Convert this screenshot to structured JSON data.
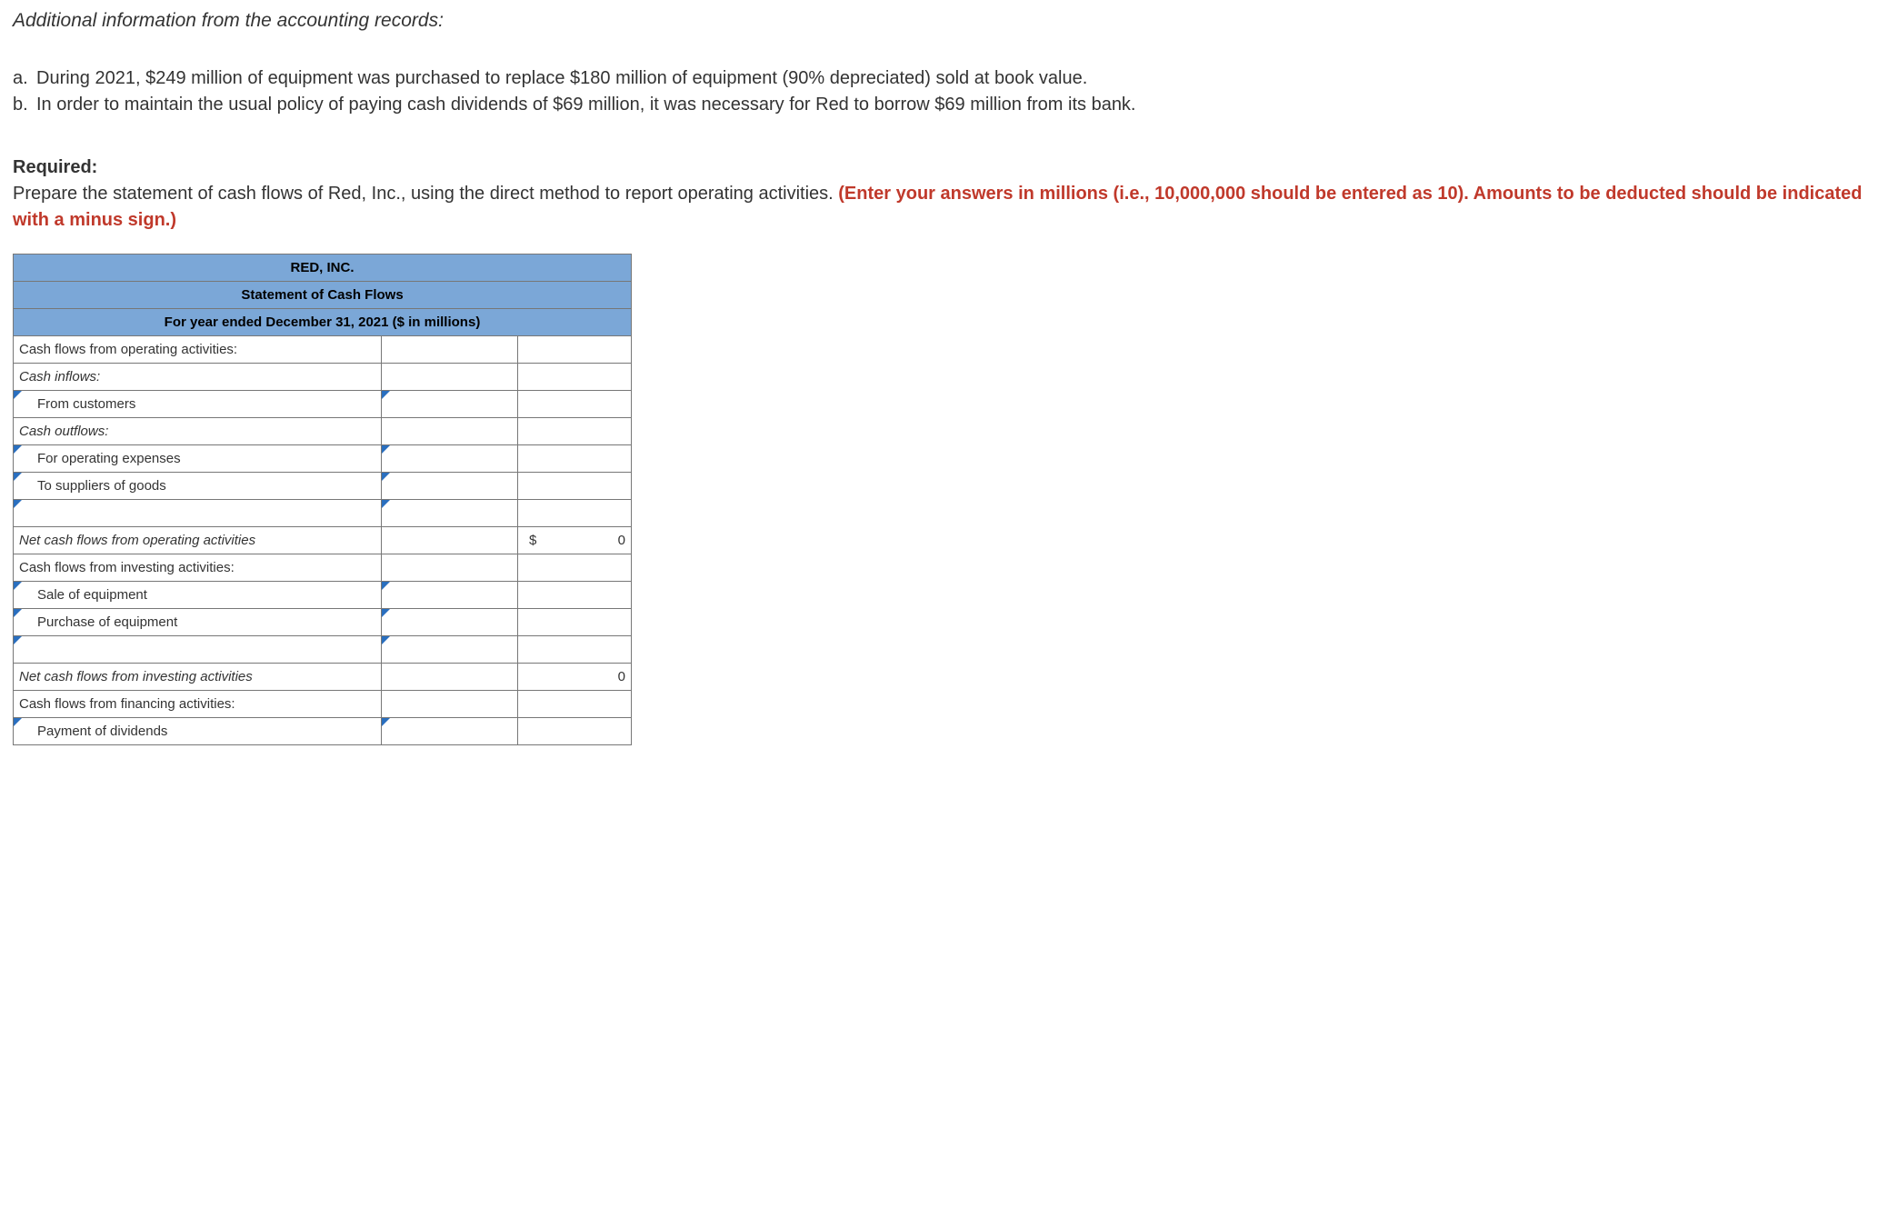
{
  "intro": "Additional information from the accounting records:",
  "info": {
    "a_marker": "a.",
    "a_text": "During 2021, $249 million of equipment was purchased to replace $180 million of equipment (90% depreciated) sold at book value.",
    "b_marker": "b.",
    "b_text": "In order to maintain the usual policy of paying cash dividends of $69 million, it was necessary for Red to borrow $69 million from its bank."
  },
  "required": {
    "label": "Required:",
    "text_black": "Prepare the statement of cash flows of Red, Inc., using the direct method to report operating activities. ",
    "text_red": "(Enter your answers in millions (i.e., 10,000,000 should be entered as 10). Amounts to be deducted should be indicated with a minus sign.)"
  },
  "headers": {
    "company": "RED, INC.",
    "title": "Statement of Cash Flows",
    "period": "For year ended December 31, 2021 ($ in millions)"
  },
  "rows": {
    "op_hdr": "Cash flows from operating activities:",
    "cash_inflows": "Cash inflows:",
    "from_customers": "From customers",
    "cash_outflows": "Cash outflows:",
    "for_op_exp": "For operating expenses",
    "to_suppliers": "To suppliers of goods",
    "net_op": "Net cash flows from operating activities",
    "inv_hdr": "Cash flows from investing activities:",
    "sale_equip": "Sale of equipment",
    "purch_equip": "Purchase of equipment",
    "net_inv": "Net cash flows from investing activities",
    "fin_hdr": "Cash flows from financing activities:",
    "pay_div": "Payment of dividends"
  },
  "vals": {
    "dollar": "$",
    "zero": "0"
  }
}
